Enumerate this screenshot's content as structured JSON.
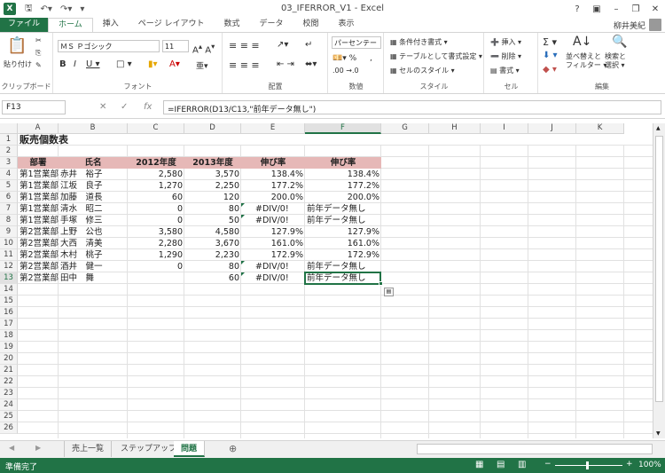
{
  "window": {
    "title": "03_IFERROR_V1 - Excel",
    "user": "柳井美紀",
    "app_icon": "X"
  },
  "tabs": [
    "ファイル",
    "ホーム",
    "挿入",
    "ページ レイアウト",
    "数式",
    "データ",
    "校閲",
    "表示"
  ],
  "ribbon": {
    "clipboard": {
      "paste": "貼り付け",
      "label": "クリップボード"
    },
    "font": {
      "name": "ＭＳ Ｐゴシック",
      "size": "11",
      "label": "フォント"
    },
    "alignment": {
      "label": "配置"
    },
    "number": {
      "format": "パーセンテー",
      "label": "数値"
    },
    "styles": {
      "conditional": "条件付き書式",
      "table": "テーブルとして書式設定",
      "cell": "セルのスタイル",
      "label": "スタイル"
    },
    "cells": {
      "insert": "挿入",
      "delete": "削除",
      "format": "書式",
      "label": "セル"
    },
    "editing": {
      "sort": "並べ替えと",
      "filter": "フィルター",
      "find": "検索と",
      "select": "選択",
      "label": "編集"
    }
  },
  "formula_bar": {
    "name_box": "F13",
    "formula": "=IFERROR(D13/C13,\"前年データ無し\")"
  },
  "columns": [
    "A",
    "B",
    "C",
    "D",
    "E",
    "F",
    "G",
    "H",
    "I",
    "J",
    "K"
  ],
  "selected_column": "F",
  "selected_row": 13,
  "sheet": {
    "title": "販売個数表",
    "headers": [
      "部署",
      "氏名",
      "2012年度",
      "2013年度",
      "伸び率",
      "伸び率"
    ],
    "rows": [
      [
        "第1営業部",
        "赤井　裕子",
        "2,580",
        "3,570",
        "138.4%",
        "138.4%"
      ],
      [
        "第1営業部",
        "江坂　良子",
        "1,270",
        "2,250",
        "177.2%",
        "177.2%"
      ],
      [
        "第1営業部",
        "加藤　道長",
        "60",
        "120",
        "200.0%",
        "200.0%"
      ],
      [
        "第1営業部",
        "清水　昭二",
        "0",
        "80",
        "#DIV/0!",
        "前年データ無し"
      ],
      [
        "第1営業部",
        "手塚　修三",
        "0",
        "50",
        "#DIV/0!",
        "前年データ無し"
      ],
      [
        "第2営業部",
        "上野　公也",
        "3,580",
        "4,580",
        "127.9%",
        "127.9%"
      ],
      [
        "第2営業部",
        "大西　清美",
        "2,280",
        "3,670",
        "161.0%",
        "161.0%"
      ],
      [
        "第2営業部",
        "木村　桃子",
        "1,290",
        "2,230",
        "172.9%",
        "172.9%"
      ],
      [
        "第2営業部",
        "酒井　健一",
        "0",
        "80",
        "#DIV/0!",
        "前年データ無し"
      ],
      [
        "第2営業部",
        "田中　舞",
        "",
        "60",
        "#DIV/0!",
        "前年データ無し"
      ]
    ]
  },
  "sheet_tabs": [
    "売上一覧",
    "ステップアップ",
    "問題"
  ],
  "active_sheet": "問題",
  "status": {
    "ready": "準備完了",
    "zoom": "100%"
  }
}
